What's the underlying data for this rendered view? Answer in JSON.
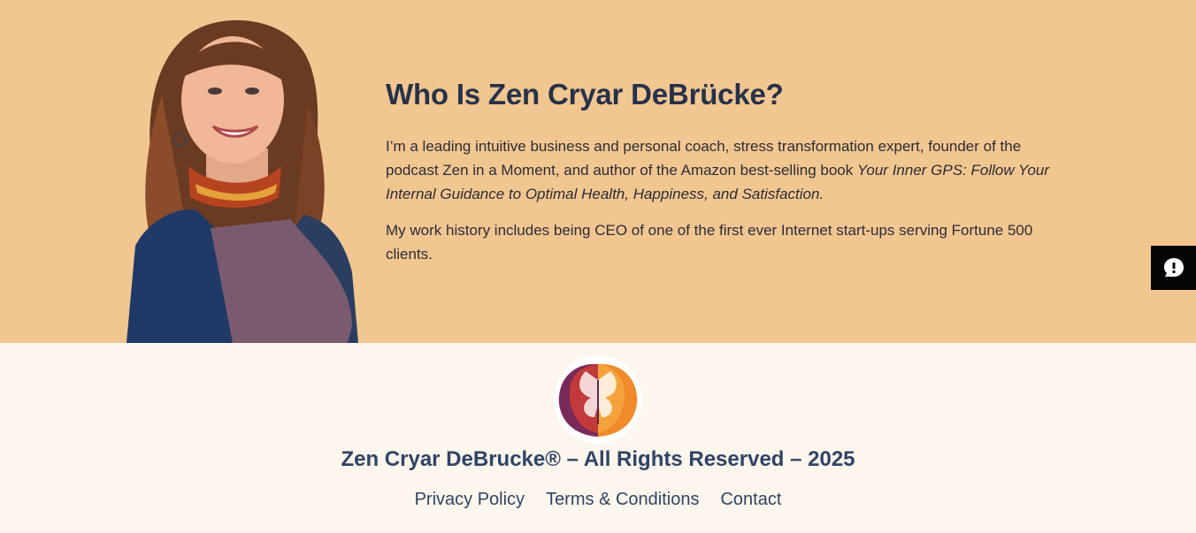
{
  "hero": {
    "heading": "Who Is Zen Cryar DeBrücke?",
    "para1_plain": "I’m a leading intuitive business and personal coach, stress transformation expert, founder of the podcast Zen in a Moment, and author of the Amazon best-selling book ",
    "para1_italic": "Your Inner GPS: Follow Your Internal Guidance to Optimal Health, Happiness, and Satisfaction.",
    "para2": "My work history includes being CEO of one of the first ever Internet start-ups serving Fortune 500 clients.",
    "background_color": "#f2c691"
  },
  "chat_widget": {
    "icon": "chat-bubble-icon",
    "color": "#050505"
  },
  "footer": {
    "logo_icon": "butterfly-brain-logo",
    "copyright": "Zen Cryar DeBrucke® – All Rights Reserved – 2025",
    "links": [
      {
        "label": "Privacy Policy"
      },
      {
        "label": "Terms & Conditions"
      },
      {
        "label": "Contact"
      }
    ],
    "background_color": "#fdf6ec",
    "text_color": "#2f4466"
  }
}
